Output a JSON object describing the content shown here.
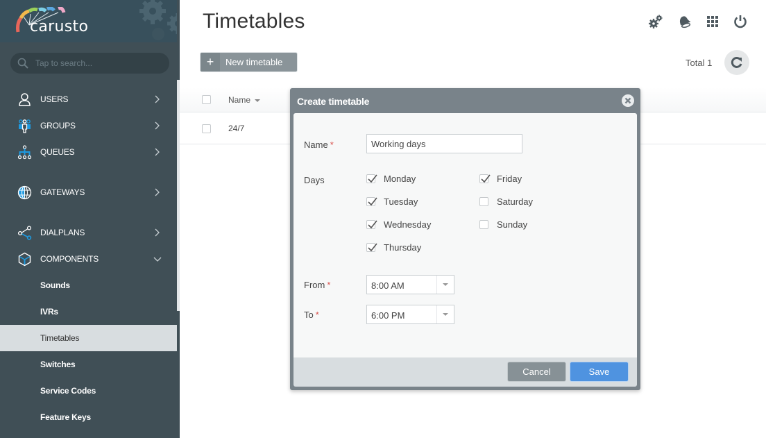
{
  "app": {
    "brand": "carusto"
  },
  "sidebar": {
    "search_placeholder": "Tap to search...",
    "nav": [
      {
        "label": "USERS",
        "icon": "user-icon",
        "expanded": false
      },
      {
        "label": "GROUPS",
        "icon": "group-icon",
        "expanded": false
      },
      {
        "label": "QUEUES",
        "icon": "queue-tree-icon",
        "expanded": false
      },
      {
        "label": "GATEWAYS",
        "icon": "globe-icon",
        "expanded": false
      },
      {
        "label": "DIALPLANS",
        "icon": "share-nodes-icon",
        "expanded": false
      },
      {
        "label": "COMPONENTS",
        "icon": "cube-icon",
        "expanded": true
      }
    ],
    "sub_items": [
      {
        "label": "Sounds",
        "active": false
      },
      {
        "label": "IVRs",
        "active": false
      },
      {
        "label": "Timetables",
        "active": true
      },
      {
        "label": "Switches",
        "active": false
      },
      {
        "label": "Service Codes",
        "active": false
      },
      {
        "label": "Feature Keys",
        "active": false
      }
    ]
  },
  "header": {
    "title": "Timetables",
    "icons": [
      "settings-gears-icon",
      "notifications-bell-icon",
      "apps-grid-icon",
      "power-icon"
    ]
  },
  "toolbar": {
    "new_button_icon": "+",
    "new_button_label": "New timetable",
    "total_label": "Total 1"
  },
  "table": {
    "columns": [
      {
        "label": "Name",
        "sort": "desc"
      }
    ],
    "rows": [
      {
        "name": "24/7",
        "selected": false
      }
    ]
  },
  "modal": {
    "title": "Create timetable",
    "name_label": "Name",
    "name_value": "Working days",
    "required_mark": "*",
    "days_label": "Days",
    "days": [
      {
        "label": "Monday",
        "checked": true
      },
      {
        "label": "Tuesday",
        "checked": true
      },
      {
        "label": "Wednesday",
        "checked": true
      },
      {
        "label": "Thursday",
        "checked": true
      },
      {
        "label": "Friday",
        "checked": true
      },
      {
        "label": "Saturday",
        "checked": false
      },
      {
        "label": "Sunday",
        "checked": false
      }
    ],
    "from_label": "From",
    "from_value": "8:00 AM",
    "to_label": "To",
    "to_value": "6:00 PM",
    "cancel_label": "Cancel",
    "save_label": "Save"
  },
  "colors": {
    "sidebar_bg": "#404f56",
    "sidebar_icon_accent": "#1e9ae0",
    "active_item_bg": "#d8dde0",
    "modal_frame": "#79838a",
    "save_button": "#4f93e0",
    "cancel_button": "#879196",
    "required": "#d9534f"
  }
}
